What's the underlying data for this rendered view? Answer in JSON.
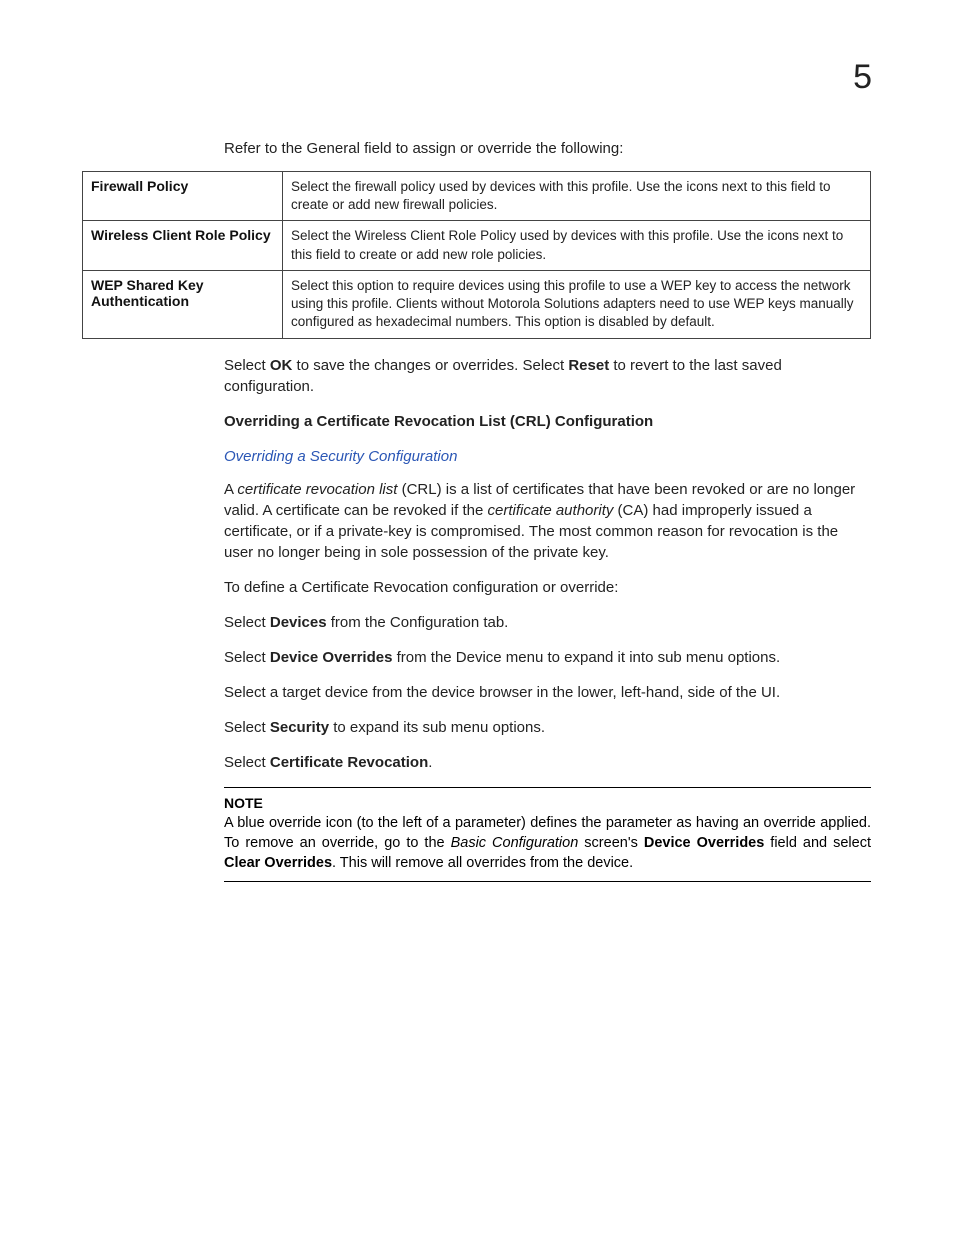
{
  "page_number": "5",
  "intro_text": "Refer to the General field to assign or override the following:",
  "table_rows": [
    {
      "label": "Firewall Policy",
      "desc": "Select the firewall policy used by devices with this profile. Use the icons next to this field to create or add new firewall policies."
    },
    {
      "label": "Wireless Client Role Policy",
      "desc": "Select the Wireless Client Role Policy used by devices with this profile. Use the icons next to this field to create or add new role policies."
    },
    {
      "label": "WEP Shared Key Authentication",
      "desc": "Select this option to require devices using this profile to use a WEP key to access the network using this profile. Clients without Motorola Solutions adapters need to use WEP keys manually configured as hexadecimal numbers. This option is disabled by default."
    }
  ],
  "save_line": {
    "pre": "Select ",
    "ok": "OK",
    "mid": " to save the changes or overrides. Select ",
    "reset": "Reset",
    "post": " to revert to the last saved configuration."
  },
  "crl_heading": "Overriding a Certificate Revocation List (CRL) Configuration",
  "crl_link": "Overriding a Security Configuration",
  "crl_para": {
    "p1a": "A ",
    "p1b_italic": "certificate revocation list",
    "p1c": " (CRL) is a list of certificates that have been revoked or are no longer valid. A certificate can be revoked if the ",
    "p1d_italic": "certificate authority",
    "p1e": " (CA) had improperly issued a certificate, or if a private-key is compromised. The most common reason for revocation is the user no longer being in sole possession of the private key."
  },
  "steps": {
    "intro": "To define a Certificate Revocation configuration or override:",
    "s1_pre": "Select ",
    "s1_b": "Devices",
    "s1_post": " from the Configuration tab.",
    "s2_pre": "Select ",
    "s2_b": "Device Overrides",
    "s2_post": " from the Device menu to expand it into sub menu options.",
    "s3": "Select a target device from the device browser in the lower, left-hand, side of the UI.",
    "s4_pre": "Select ",
    "s4_b": "Security",
    "s4_post": " to expand its sub menu options.",
    "s5_pre": "Select ",
    "s5_b": "Certificate Revocation",
    "s5_post": "."
  },
  "note": {
    "label": "NOTE",
    "t1": "A blue override icon (to the left of a parameter) defines the parameter as having an override applied. To remove an override, go to the ",
    "t2_italic": "Basic Configuration",
    "t3": " screen's ",
    "t4_b": "Device Overrides",
    "t5": " field and select ",
    "t6_b": "Clear Overrides",
    "t7": ". This will remove all overrides from the device."
  }
}
